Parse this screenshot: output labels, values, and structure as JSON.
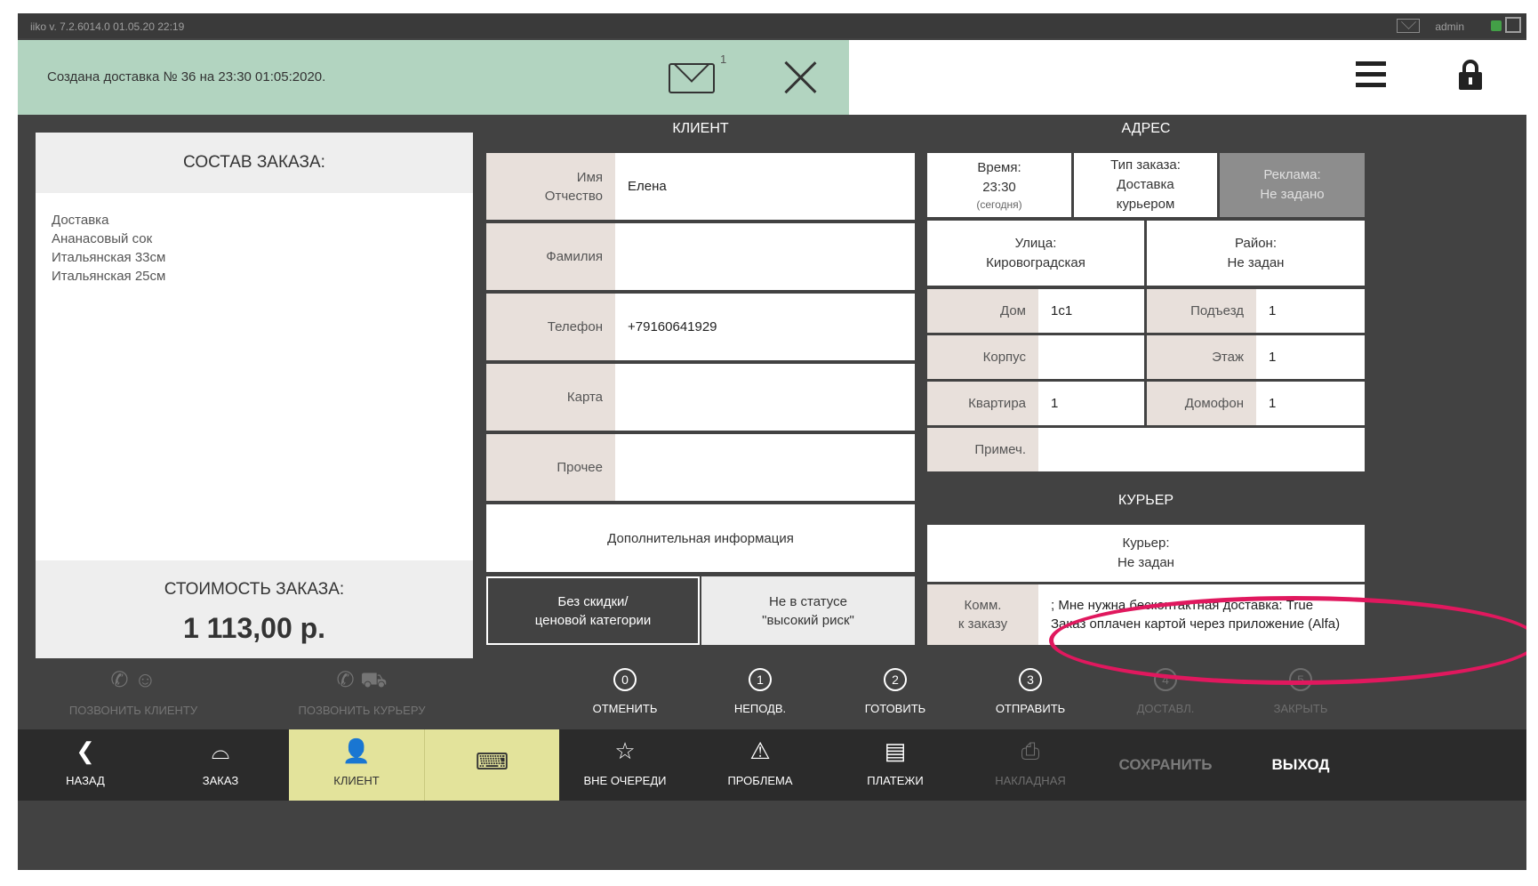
{
  "titlebar": {
    "version": "iiko  v. 7.2.6014.0      01.05.20   22:19",
    "user": "admin"
  },
  "notification": {
    "text": "Создана доставка № 36 на 23:30 01:05:2020.",
    "count": "1"
  },
  "order": {
    "title": "СОСТАВ ЗАКАЗА:",
    "items": [
      "Доставка",
      "Ананасовый сок",
      "Итальянская 33см",
      "Итальянская 25см"
    ],
    "cost_label": "СТОИМОСТЬ ЗАКАЗА:",
    "total": "1 113,00 р."
  },
  "client": {
    "header": "КЛИЕНТ",
    "name_label": "Имя\nОтчество",
    "name_value": "Елена",
    "surname_label": "Фамилия",
    "surname_value": "",
    "phone_label": "Телефон",
    "phone_value": "+79160641929",
    "card_label": "Карта",
    "card_value": "",
    "other_label": "Прочее",
    "other_value": "",
    "extra_info": "Дополнительная информация",
    "discount_button": "Без скидки/\nценовой категории",
    "risk_button": "Не в статусе\n\"высокий риск\""
  },
  "address": {
    "header": "АДРЕС",
    "time_label": "Время:",
    "time_value": "23:30",
    "time_sub": "(сегодня)",
    "order_type_label": "Тип заказа:",
    "order_type_value": "Доставка\nкурьером",
    "ad_label": "Реклама:",
    "ad_value": "Не задано",
    "street_label": "Улица:",
    "street_value": "Кировоградская",
    "district_label": "Район:",
    "district_value": "Не задан",
    "house_label": "Дом",
    "house_value": "1с1",
    "entrance_label": "Подъезд",
    "entrance_value": "1",
    "building_label": "Корпус",
    "building_value": "",
    "floor_label": "Этаж",
    "floor_value": "1",
    "apartment_label": "Квартира",
    "apartment_value": "1",
    "intercom_label": "Домофон",
    "intercom_value": "1",
    "note_label": "Примеч.",
    "note_value": ""
  },
  "courier": {
    "header": "КУРЬЕР",
    "label": "Курьер:",
    "value": "Не задан",
    "comment_label": "Комм.\nк заказу",
    "comment_value": "; Мне нужна бесконтактная доставка: True\nЗаказ оплачен картой через приложение (Alfa)"
  },
  "calls": {
    "call_client": "ПОЗВОНИТЬ КЛИЕНТУ",
    "call_courier": "ПОЗВОНИТЬ КУРЬЕРУ"
  },
  "statuses": [
    {
      "num": "0",
      "label": "ОТМЕНИТЬ"
    },
    {
      "num": "1",
      "label": "НЕПОДВ."
    },
    {
      "num": "2",
      "label": "ГОТОВИТЬ"
    },
    {
      "num": "3",
      "label": "ОТПРАВИТЬ"
    },
    {
      "num": "4",
      "label": "ДОСТАВЛ."
    },
    {
      "num": "5",
      "label": "ЗАКРЫТЬ"
    }
  ],
  "bottom": {
    "back": "НАЗАД",
    "order": "ЗАКАЗ",
    "client": "КЛИЕНТ",
    "out_of_turn": "ВНЕ ОЧЕРЕДИ",
    "problem": "ПРОБЛЕМА",
    "payments": "ПЛАТЕЖИ",
    "invoice": "НАКЛАДНАЯ",
    "save": "СОХРАНИТЬ",
    "exit": "ВЫХОД"
  },
  "colors": {
    "notification_bg": "#b2d4c0",
    "active_tab": "#e3e39b",
    "label_bg": "#e8e0db",
    "highlight": "#e0185e"
  }
}
